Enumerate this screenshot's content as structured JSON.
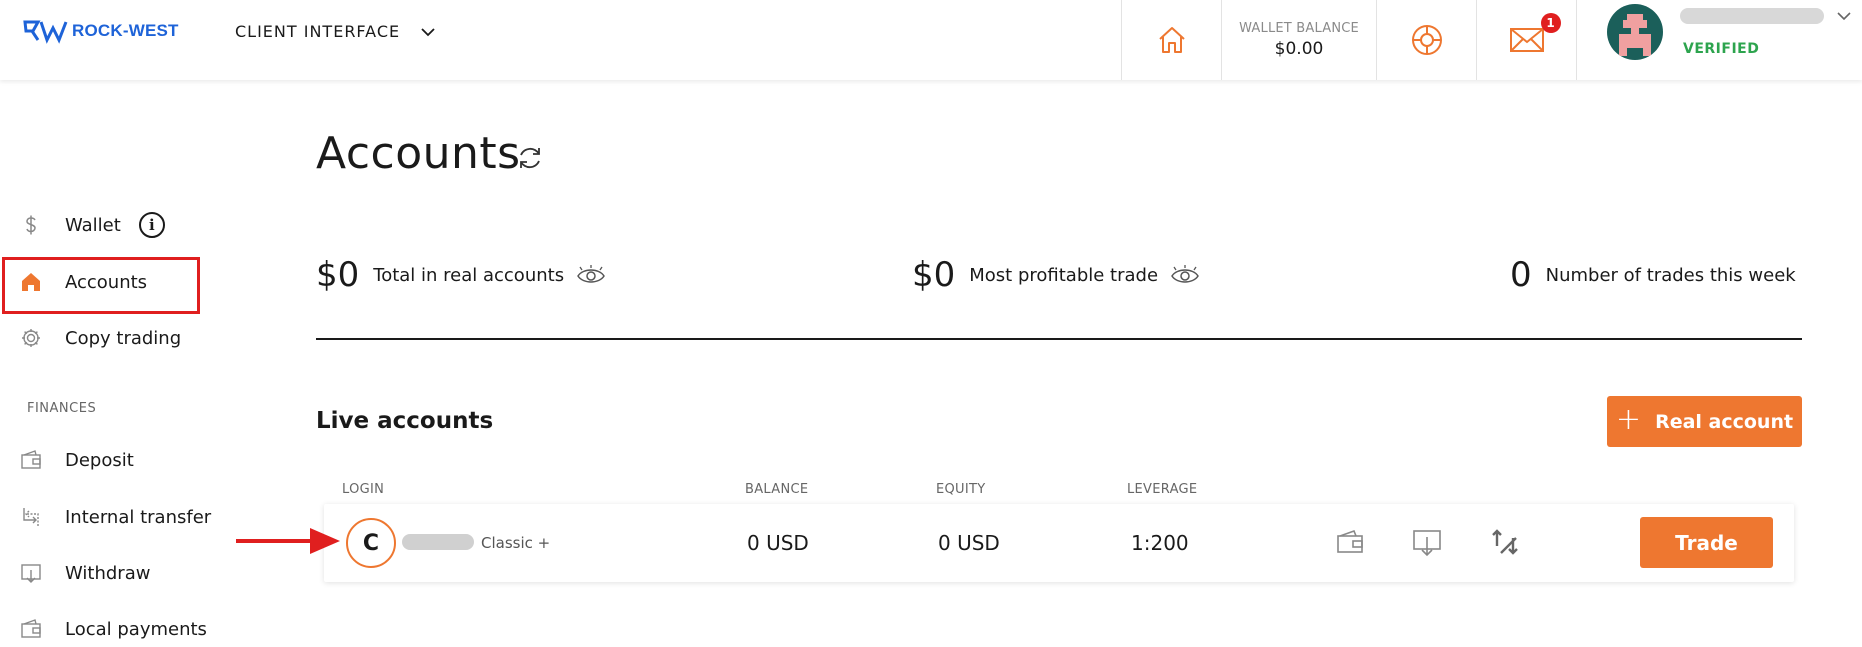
{
  "header": {
    "logo_text": "ROCK-WEST",
    "client_interface_label": "CLIENT INTERFACE",
    "wallet_balance_label": "WALLET BALANCE",
    "wallet_balance_value": "$0.00",
    "notifications_count": "1",
    "user_status": "VERIFIED"
  },
  "sidebar": {
    "items": [
      {
        "label": "Wallet",
        "icon": "dollar-icon"
      },
      {
        "label": "Accounts",
        "icon": "home-icon"
      },
      {
        "label": "Copy trading",
        "icon": "gear-icon"
      }
    ],
    "finances_label": "FINANCES",
    "finance_items": [
      {
        "label": "Deposit",
        "icon": "wallet-icon"
      },
      {
        "label": "Internal transfer",
        "icon": "transfer-icon"
      },
      {
        "label": "Withdraw",
        "icon": "withdraw-icon"
      },
      {
        "label": "Local payments",
        "icon": "wallet-icon"
      }
    ]
  },
  "main": {
    "title": "Accounts",
    "stats": [
      {
        "value": "$0",
        "label": "Total in real accounts"
      },
      {
        "value": "$0",
        "label": "Most profitable trade"
      },
      {
        "value": "0",
        "label": "Number of trades this week"
      }
    ],
    "live_accounts_title": "Live accounts",
    "real_account_button": "Real account",
    "columns": [
      "LOGIN",
      "BALANCE",
      "EQUITY",
      "LEVERAGE"
    ],
    "account": {
      "initial": "C",
      "type": "Classic +",
      "balance": "0 USD",
      "equity": "0 USD",
      "leverage": "1:200",
      "trade_button": "Trade"
    }
  },
  "colors": {
    "accent": "#ee7730",
    "brand": "#1e63d8",
    "verified": "#2da44e",
    "annotation_red": "#e01f1f"
  }
}
